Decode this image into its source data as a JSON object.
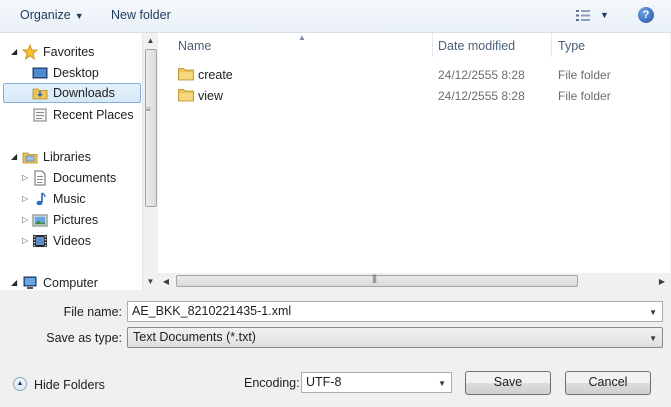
{
  "toolbar": {
    "organize_label": "Organize",
    "new_folder_label": "New folder",
    "views_icon": "views-icon",
    "help_icon": "help-icon"
  },
  "nav": {
    "favorites_label": "Favorites",
    "desktop_label": "Desktop",
    "downloads_label": "Downloads",
    "recent_places_label": "Recent Places",
    "libraries_label": "Libraries",
    "documents_label": "Documents",
    "music_label": "Music",
    "pictures_label": "Pictures",
    "videos_label": "Videos",
    "computer_label": "Computer"
  },
  "filelist": {
    "col_name": "Name",
    "col_date": "Date modified",
    "col_type": "Type",
    "rows": [
      {
        "name": "create",
        "date": "24/12/2555 8:28",
        "type": "File folder"
      },
      {
        "name": "view",
        "date": "24/12/2555 8:28",
        "type": "File folder"
      }
    ]
  },
  "form": {
    "file_name_label": "File name:",
    "file_name_value": "AE_BKK_8210221435-1.xml",
    "save_as_type_label": "Save as type:",
    "save_as_type_value": "Text Documents (*.txt)",
    "encoding_label": "Encoding:",
    "encoding_value": "UTF-8",
    "save_label": "Save",
    "cancel_label": "Cancel",
    "hide_folders_label": "Hide Folders"
  },
  "colors": {
    "selection_border": "#84acdd",
    "link_text": "#1e395b"
  }
}
